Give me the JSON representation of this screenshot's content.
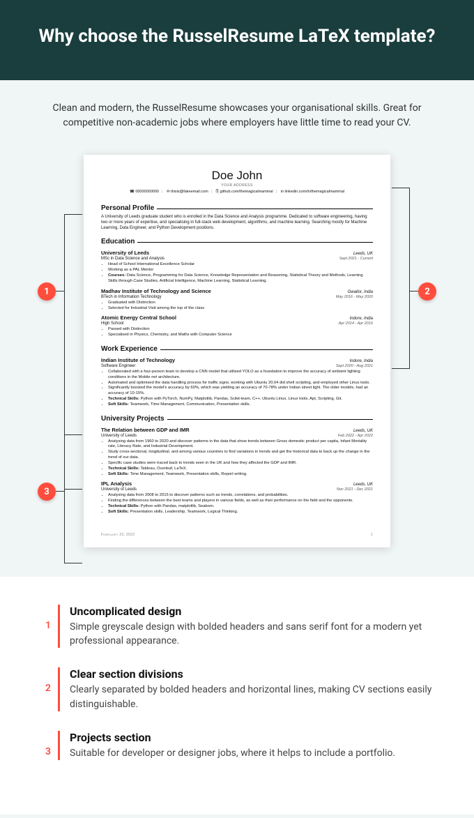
{
  "header": {
    "title": "Why choose the RusselResume LaTeX template?"
  },
  "intro": "Clean and modern, the RusselResume showcases your organisational skills. Great for competitive non-academic jobs where employers have little time to read your CV.",
  "markers": {
    "m1": "1",
    "m2": "2",
    "m3": "3"
  },
  "resume": {
    "name": "Doe John",
    "addr": "YOUR ADDRESS",
    "contacts": {
      "phone": "☎ 00000000000",
      "email": "✉ thisis@fakeemail.com",
      "github": "⎘ github.com/themagicalmammal",
      "linkedin": "in linkedin.com/in/themagicalmammal"
    },
    "profile_title": "Personal Profile",
    "profile": "A University of Leeds graduate student who is enrolled in the Data Science and Analysis programme. Dedicated to software engineering, having two or more years of expertise, and specialising in full-stack web development, algorithms, and machine learning. Searching mostly for Machine Learning, Data Engineer, and Python Development positions.",
    "edu_title": "Education",
    "education": [
      {
        "inst": "University of Leeds",
        "loc": "Leeds, UK",
        "degree": "MSc in Data Science and Analysis",
        "dates": "Sept 2021 - Current",
        "bullets": [
          "Head of School International Excellence Scholar",
          "Working as a PAL Mentor",
          "Courses: Data Science, Programming for Data Science, Knowledge Representation and Reasoning, Statistical Theory and Methods, Learning Skills through Case Studies, Artificial Intelligence, Machine Learning, Statistical Learning."
        ]
      },
      {
        "inst": "Madhav Institute of Technology and Science",
        "loc": "Gwalior, India",
        "degree": "BTech in Information Technology",
        "dates": "May 2016 - May 2020",
        "bullets": [
          "Graduated with Distinction",
          "Selected for Industrial Visit among the top of the class"
        ]
      },
      {
        "inst": "Atomic Energy Central School",
        "loc": "Indore, India",
        "degree": "High School",
        "dates": "Apr 2014 - Apr 2016",
        "bullets": [
          "Passed with Distinction",
          "Specialised in Physics, Chemistry, and Maths with Computer Science"
        ]
      }
    ],
    "work_title": "Work Experience",
    "work": [
      {
        "inst": "Indian Institute of Technology",
        "loc": "Indore, India",
        "degree": "Software Engineer",
        "dates": "Sept 2020 - Aug 2021",
        "bullets": [
          "Collaborated with a four-person team to develop a CNN model that utilised YOLO as a foundation to improve the accuracy of ambient lighting conditions in the Mobile net architecture.",
          "Automated and optimised the data handling process for traffic signs; working with Ubuntu 20.04 did shell scripting, and employed other Linux tools.",
          "Significantly boosted the model's accuracy by 60%, which was yielding an accuracy of 70-78% under Indian street light. The older models, had an accuracy of 10-15%.",
          "Technical Skills: Python with PyTorch, NumPy, Matplotlib, Pandas, Scikit-learn, C++, Ubuntu Linux, Linux tools, Apt, Scripting, Git.",
          "Soft Skills: Teamwork, Time Management, Communication, Presentation skills."
        ]
      }
    ],
    "proj_title": "University Projects",
    "projects": [
      {
        "inst": "The Relation between GDP and IMR",
        "loc": "Leeds, UK",
        "degree": "University of Leeds",
        "dates": "Feb 2022 - Apr 2022",
        "bullets": [
          "Analysing data from 1960 to 2020 and discover patterns in the data that show trends between Gross domestic product per capita, Infant Mortality rate, Literacy Rate, and Industrial Development.",
          "Study cross-sectional, longitudinal, and among various countries to find variations in trends and get the historical data to back up the change in the trend of our data.",
          "Specific case studies were traced back to trends seen in the UK and how they affected the GDP and IMR.",
          "Technical Skills: Tableau, Overleaf, LaTeX.",
          "Soft Skills: Time Management, Teamwork, Presentation skills, Report writing."
        ]
      },
      {
        "inst": "IPL Analysis",
        "loc": "Leeds, UK",
        "degree": "University of Leeds",
        "dates": "Nov 2021 - Dec 2021",
        "bullets": [
          "Analysing data from 2008 to 2015 to discover patterns such as trends, correlations, and probabilities.",
          "Finding the differences between the best teams and players in various fields, as well as their performance on the field and the opponents.",
          "Technical Skills: Python with Pandas, matplotlib, Seaborn.",
          "Soft Skills: Presentation skills, Leadership, Teamwork, Logical Thinking."
        ]
      }
    ],
    "footer_date": "February 23, 2022",
    "footer_page": "1"
  },
  "features": [
    {
      "num": "1",
      "title": "Uncomplicated design",
      "desc": "Simple greyscale design with bolded headers and sans serif font for a modern yet professional appearance."
    },
    {
      "num": "2",
      "title": "Clear section divisions",
      "desc": "Clearly separated by bolded headers and horizontal lines, making CV sections easily distinguishable."
    },
    {
      "num": "3",
      "title": "Projects section",
      "desc": "Suitable for developer or designer jobs, where it helps to include a portfolio."
    }
  ]
}
